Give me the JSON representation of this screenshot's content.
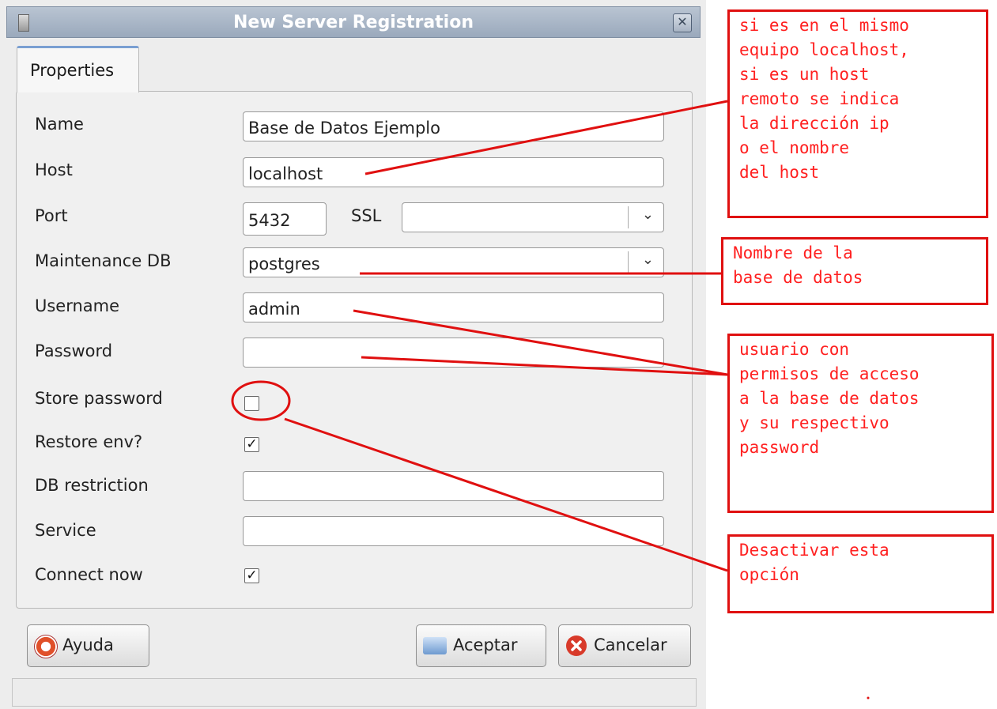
{
  "window": {
    "title": "New Server Registration",
    "close_glyph": "✕"
  },
  "tabs": [
    "Properties"
  ],
  "form": {
    "name_label": "Name",
    "name_value": "Base de Datos Ejemplo",
    "host_label": "Host",
    "host_value": "localhost",
    "port_label": "Port",
    "port_value": "5432",
    "ssl_label": "SSL",
    "ssl_value": "",
    "maintenance_db_label": "Maintenance DB",
    "maintenance_db_value": "postgres",
    "username_label": "Username",
    "username_value": "admin",
    "password_label": "Password",
    "password_value": "",
    "store_password_label": "Store password",
    "store_password_checked": false,
    "restore_env_label": "Restore env?",
    "restore_env_checked": true,
    "db_restriction_label": "DB restriction",
    "db_restriction_value": "",
    "service_label": "Service",
    "service_value": "",
    "connect_now_label": "Connect now",
    "connect_now_checked": true,
    "check_glyph": "✓",
    "dropdown_glyph": "⌄"
  },
  "buttons": {
    "help_label": "Ayuda",
    "ok_label": "Aceptar",
    "cancel_label": "Cancelar"
  },
  "annotations": {
    "host_note": "si es en el mismo\nequipo localhost,\nsi es un host\nremoto se indica\nla dirección ip\no el nombre\ndel host",
    "db_note": "Nombre de la\nbase de datos",
    "user_note": "usuario con\npermisos de acceso\na la base de datos\ny su respectivo\npassword",
    "store_note": "Desactivar esta\nopción",
    "color": "#e01010"
  }
}
